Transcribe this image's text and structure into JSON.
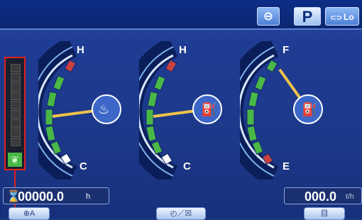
{
  "topbar": {
    "buttons": [
      {
        "label": "⊝",
        "icon": "wiper-icon"
      },
      {
        "label": "P",
        "icon": "parking-icon"
      },
      {
        "label": "Lo",
        "icon": "travel-speed-icon"
      }
    ]
  },
  "gauges": [
    {
      "name": "engine-coolant",
      "high_label": "H",
      "low_label": "C",
      "level": 0.45,
      "icon": "coolant-temp-icon"
    },
    {
      "name": "hydraulic-oil",
      "high_label": "H",
      "low_label": "C",
      "level": 0.45,
      "icon": "hydraulic-oil-temp-icon"
    },
    {
      "name": "fuel",
      "high_label": "F",
      "low_label": "E",
      "level": 0.85,
      "icon": "fuel-pump-icon"
    }
  ],
  "hour_meter": {
    "value": "00000.0",
    "unit": "h"
  },
  "fuel_rate": {
    "value": "000.0",
    "unit": "ℓ/h"
  },
  "bottom_buttons": [
    {
      "label": "⊕A",
      "icon": "menu-icon"
    },
    {
      "label": "◴／☒",
      "icon": "clock-camera-icon"
    },
    {
      "label": "目",
      "icon": "info-icon"
    }
  ],
  "colors": {
    "background": "#1d3a8c",
    "green": "#49b847",
    "red": "#e02020",
    "needle": "#f0c24a"
  }
}
